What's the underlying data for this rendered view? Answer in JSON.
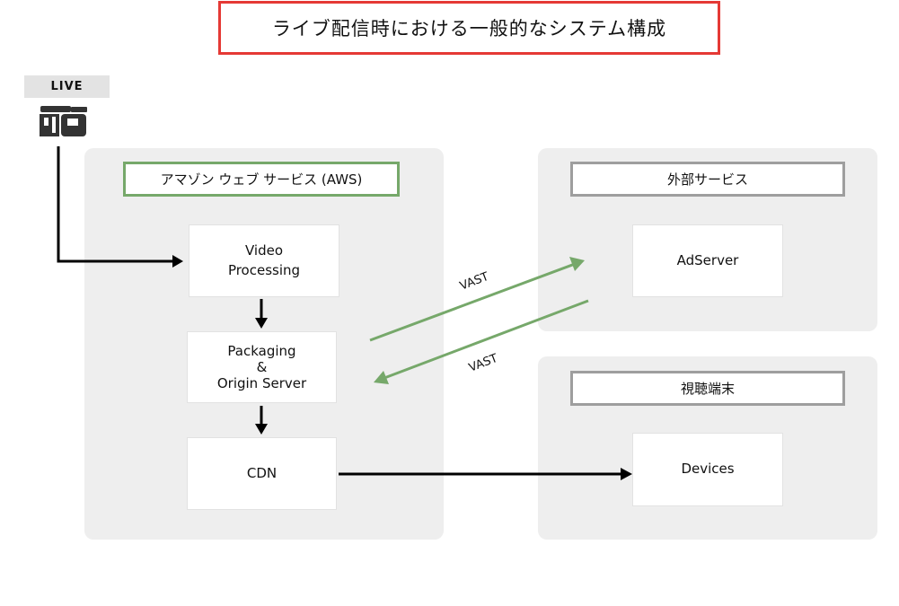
{
  "title": "ライブ配信時における一般的なシステム構成",
  "source": {
    "label": "LIVE",
    "icon": "video-camera-icon"
  },
  "groups": {
    "aws": {
      "header": "アマゾン ウェブ サービス (AWS)",
      "border_color": "#76a86a"
    },
    "external": {
      "header": "外部サービス",
      "border_color": "#9e9e9e"
    },
    "devices": {
      "header": "視聴端末",
      "border_color": "#9e9e9e"
    }
  },
  "nodes": {
    "video_processing": "Video\nProcessing",
    "packaging": "Packaging\n&\nOrigin Server",
    "cdn": "CDN",
    "adserver": "AdServer",
    "devices": "Devices"
  },
  "edges": [
    {
      "from": "LIVE",
      "to": "Video Processing",
      "label": "",
      "color": "#000000"
    },
    {
      "from": "Video Processing",
      "to": "Packaging & Origin Server",
      "label": "",
      "color": "#000000"
    },
    {
      "from": "Packaging & Origin Server",
      "to": "CDN",
      "label": "",
      "color": "#000000"
    },
    {
      "from": "CDN",
      "to": "Devices",
      "label": "",
      "color": "#000000"
    },
    {
      "from": "Packaging & Origin Server",
      "to": "AdServer",
      "label": "VAST",
      "color": "#76a86a"
    },
    {
      "from": "AdServer",
      "to": "Packaging & Origin Server",
      "label": "VAST",
      "color": "#76a86a"
    }
  ],
  "colors": {
    "title_border": "#e53935",
    "panel_bg": "#eeeeee",
    "vast_arrow": "#76a86a"
  }
}
